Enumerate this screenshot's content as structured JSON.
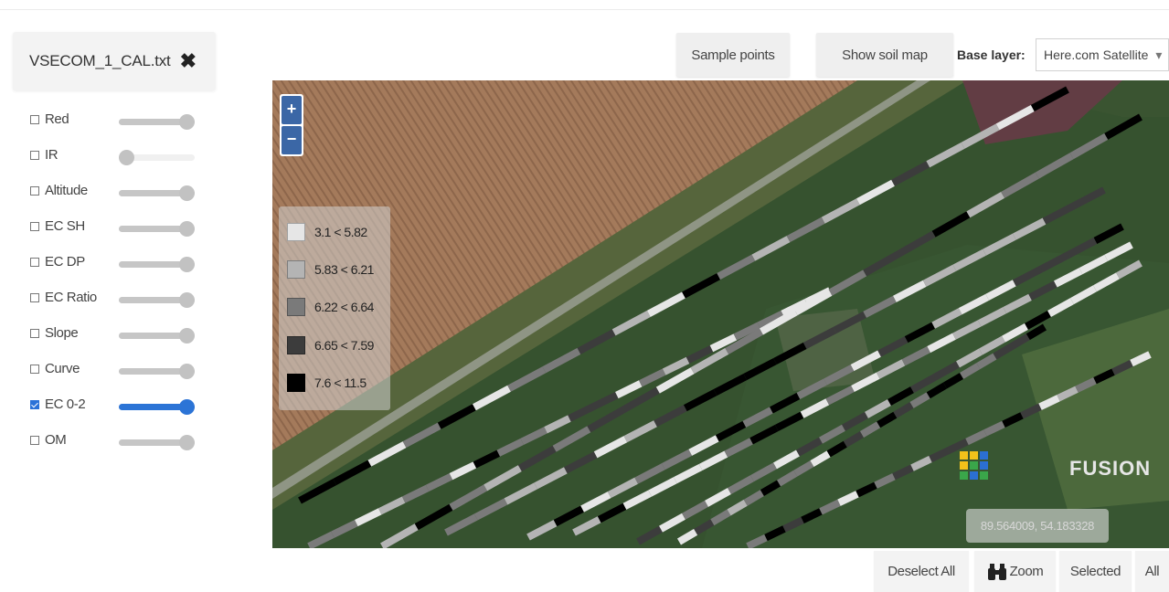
{
  "file": {
    "name": "VSECOM_1_CAL.txt",
    "close_icon": "close-icon"
  },
  "layers": [
    {
      "label": "Red",
      "checked": false,
      "value": 1.0
    },
    {
      "label": "IR",
      "checked": false,
      "value": 0.0
    },
    {
      "label": "Altitude",
      "checked": false,
      "value": 1.0
    },
    {
      "label": "EC SH",
      "checked": false,
      "value": 1.0
    },
    {
      "label": "EC DP",
      "checked": false,
      "value": 1.0
    },
    {
      "label": "EC Ratio",
      "checked": false,
      "value": 1.0
    },
    {
      "label": "Slope",
      "checked": false,
      "value": 1.0
    },
    {
      "label": "Curve",
      "checked": false,
      "value": 1.0
    },
    {
      "label": "EC 0-2",
      "checked": true,
      "value": 1.0
    },
    {
      "label": "OM",
      "checked": false,
      "value": 1.0
    }
  ],
  "toolbar": {
    "sample_points": "Sample points",
    "show_soil_map": "Show soil map",
    "base_layer_label": "Base layer:",
    "base_layer_value": "Here.com Satellite"
  },
  "map": {
    "zoom_in": "+",
    "zoom_out": "−",
    "legend": [
      {
        "label": "3.1 < 5.82",
        "color": "#e6e6e6"
      },
      {
        "label": "5.83 < 6.21",
        "color": "#b4b4b4"
      },
      {
        "label": "6.22 < 6.64",
        "color": "#7a7a7a"
      },
      {
        "label": "6.65 < 7.59",
        "color": "#3c3c3c"
      },
      {
        "label": "7.6 < 11.5",
        "color": "#000000"
      }
    ],
    "logo_text": "FUSION",
    "coordinates": "89.564009, 54.183328"
  },
  "bottom": {
    "deselect_all": "Deselect All",
    "zoom": "Zoom",
    "zoom_icon": "binoculars-icon",
    "selected": "Selected",
    "all": "All"
  }
}
